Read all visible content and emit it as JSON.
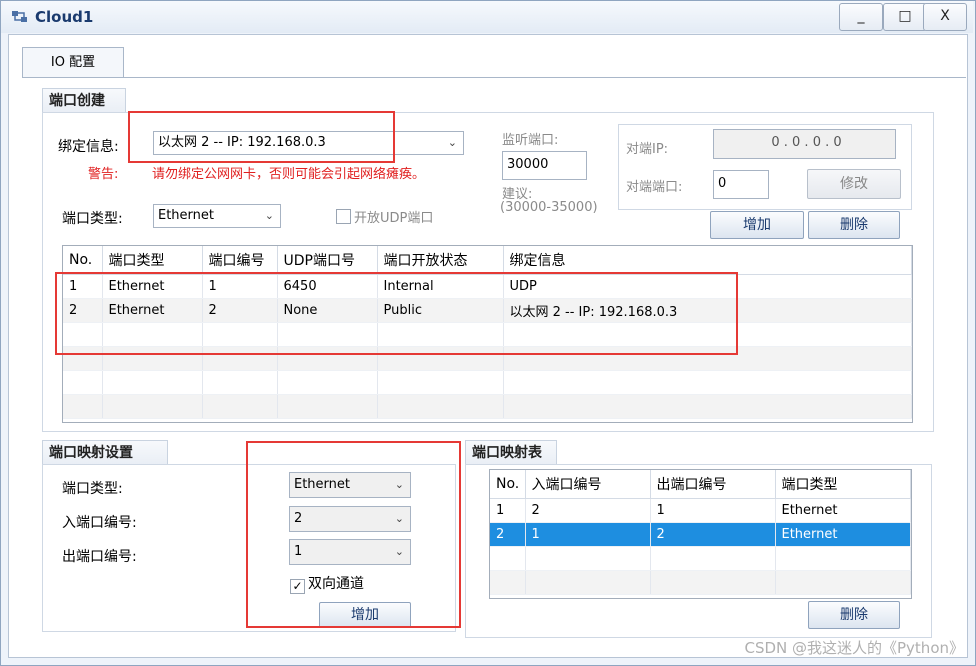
{
  "window": {
    "title": "Cloud1",
    "buttons": {
      "minimize": "_",
      "maximize": "□",
      "close": "X"
    }
  },
  "tabs": [
    {
      "label": "IO 配置"
    }
  ],
  "port_create": {
    "header": "端口创建",
    "bind_label": "绑定信息:",
    "bind_value": "以太网 2 -- IP: 192.168.0.3",
    "warning_label": "警告:",
    "warning_text": "请勿绑定公网网卡，否则可能会引起网络瘫痪。",
    "port_type_label": "端口类型:",
    "port_type_value": "Ethernet",
    "udp_checkbox_label": "开放UDP端口",
    "listen_port_label": "监听端口:",
    "listen_port_value": "30000",
    "suggest_label": "建议:",
    "suggest_range": "(30000-35000)",
    "peer_ip_label": "对端IP:",
    "peer_ip_value": "0 . 0 . 0 . 0",
    "peer_port_label": "对端端口:",
    "peer_port_value": "0",
    "modify_button": "修改",
    "add_button": "增加",
    "delete_button": "删除",
    "table": {
      "columns": [
        "No.",
        "端口类型",
        "端口编号",
        "UDP端口号",
        "端口开放状态",
        "绑定信息"
      ],
      "rows": [
        [
          "1",
          "Ethernet",
          "1",
          "6450",
          "Internal",
          "UDP"
        ],
        [
          "2",
          "Ethernet",
          "2",
          "None",
          "Public",
          "以太网 2 -- IP: 192.168.0.3"
        ]
      ]
    }
  },
  "port_mapping_settings": {
    "header": "端口映射设置",
    "port_type_label": "端口类型:",
    "port_type_value": "Ethernet",
    "in_port_label": "入端口编号:",
    "in_port_value": "2",
    "out_port_label": "出端口编号:",
    "out_port_value": "1",
    "bidirectional_label": "双向通道",
    "bidirectional_checked": true,
    "add_button": "增加"
  },
  "port_mapping_table": {
    "header": "端口映射表",
    "columns": [
      "No.",
      "入端口编号",
      "出端口编号",
      "端口类型"
    ],
    "rows": [
      [
        "1",
        "2",
        "1",
        "Ethernet"
      ],
      [
        "2",
        "1",
        "2",
        "Ethernet"
      ]
    ],
    "selected_row": 2,
    "delete_button": "删除"
  },
  "watermark": "CSDN @我这迷人的《Python》",
  "colors": {
    "selection": "#1e8ee0",
    "annotation": "#e53935",
    "warning": "#e02020"
  }
}
